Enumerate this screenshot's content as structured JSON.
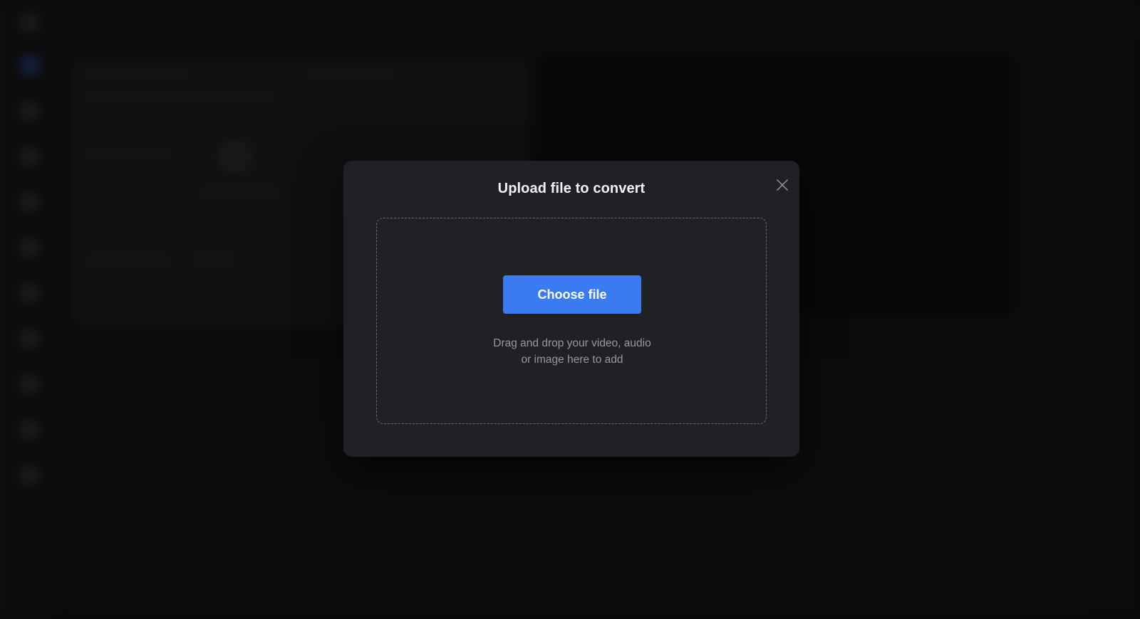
{
  "modal": {
    "title": "Upload file to convert",
    "close_icon": "close-icon",
    "choose_button_label": "Choose file",
    "hint_line1": "Drag and drop your video, audio",
    "hint_line2": "or image here to add"
  },
  "colors": {
    "accent": "#3b7bf2",
    "modal_bg": "#212125",
    "page_bg": "#0f0f10"
  }
}
